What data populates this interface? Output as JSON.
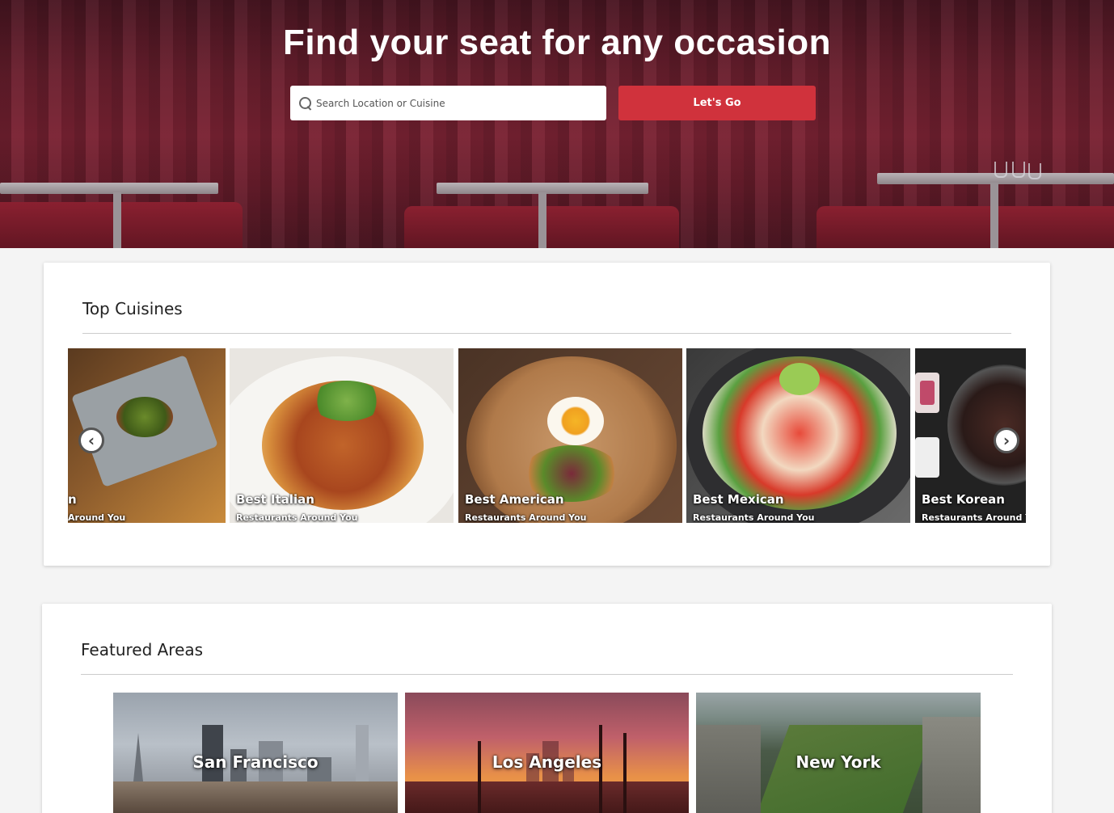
{
  "hero": {
    "title": "Find your seat for any occasion",
    "search_placeholder": "Search Location or Cuisine",
    "search_value": "",
    "go_label": "Let's Go",
    "accent_color": "#d0323c"
  },
  "cuisines": {
    "heading": "Top Cuisines",
    "tiles": [
      {
        "title": "Best Japanese",
        "subtitle": "Restaurants Around You",
        "visible_title": "n",
        "visible_subtitle": "Around You"
      },
      {
        "title": "Best Italian",
        "subtitle": "Restaurants Around You"
      },
      {
        "title": "Best American",
        "subtitle": "Restaurants Around You"
      },
      {
        "title": "Best Mexican",
        "subtitle": "Restaurants Around You"
      },
      {
        "title": "Best Korean",
        "subtitle": "Restaurants Around Yo"
      }
    ],
    "prev_icon": "chevron-left-icon",
    "next_icon": "chevron-right-icon"
  },
  "areas": {
    "heading": "Featured Areas",
    "items": [
      {
        "name": "San Francisco"
      },
      {
        "name": "Los Angeles"
      },
      {
        "name": "New York"
      }
    ]
  }
}
